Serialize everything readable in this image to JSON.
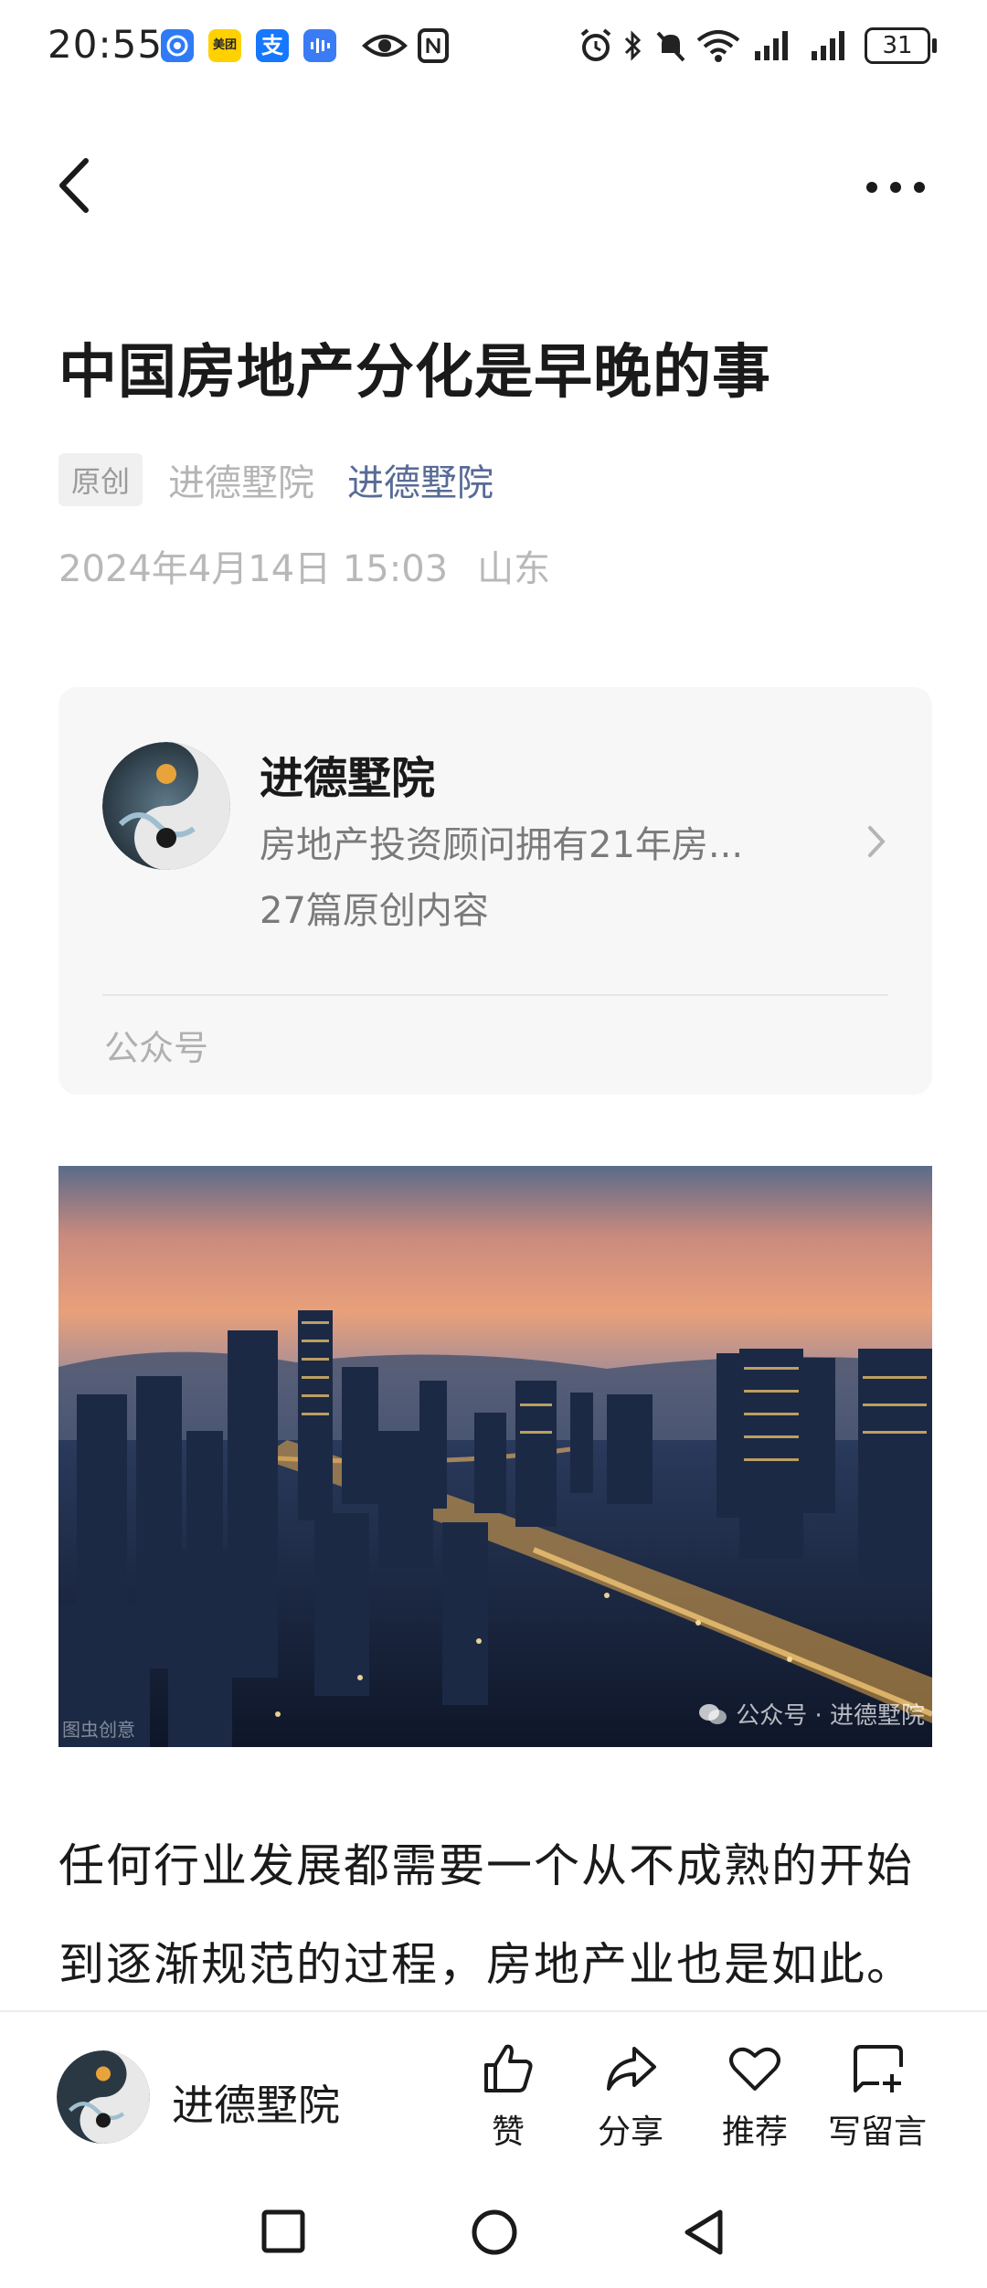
{
  "status_bar": {
    "time": "20:55",
    "battery": "31",
    "apps": [
      "meituan-app",
      "alipay-app"
    ],
    "meituan_label": "美团",
    "alipay_label": "支"
  },
  "nav": {
    "back_icon": "chevron-left-icon",
    "more_icon": "more-dots-icon"
  },
  "article": {
    "title": "中国房地产分化是早晚的事",
    "original_tag": "原创",
    "author_plain": "进德墅院",
    "author_link": "进德墅院",
    "date": "2024年4月14日 15:03",
    "location": "山东",
    "paragraph": "任何行业发展都需要一个从不成熟的开始到逐渐规范的过程，房地产业也是如此。"
  },
  "account_card": {
    "name": "进德墅院",
    "description": "房地产投资顾问拥有21年房...",
    "original_count": "27篇原创内容",
    "footer": "公众号"
  },
  "hero_image": {
    "watermark_left": "图虫创意",
    "watermark_right": "公众号 · 进德墅院"
  },
  "bottom_bar": {
    "name": "进德墅院",
    "like": "赞",
    "share": "分享",
    "recommend": "推荐",
    "comment": "写留言"
  },
  "colors": {
    "link": "#576b95",
    "muted": "#b8b8b8",
    "card_bg": "#f7f7f7"
  }
}
